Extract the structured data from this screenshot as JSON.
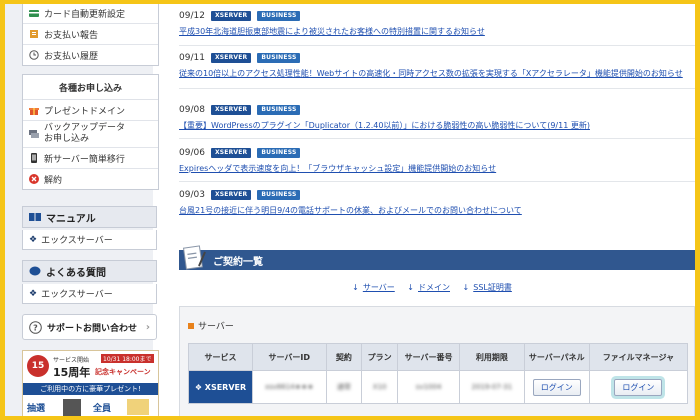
{
  "sidebar": {
    "top_items": [
      {
        "label": "カード自動更新設定",
        "icon": "card-icon"
      },
      {
        "label": "お支払い報告",
        "icon": "report-icon"
      },
      {
        "label": "お支払い履歴",
        "icon": "clock-icon"
      }
    ],
    "apply_category": "各種お申し込み",
    "apply_items": [
      {
        "label": "プレゼントドメイン",
        "icon": "gift-icon"
      },
      {
        "label": "バックアップデータ",
        "label2": "お申し込み",
        "icon": "backup-icon"
      },
      {
        "label": "新サーバー簡単移行",
        "icon": "phone-icon"
      },
      {
        "label": "解約",
        "icon": "cancel-icon"
      }
    ],
    "manual": {
      "title": "マニュアル",
      "sub": "エックスサーバー"
    },
    "faq": {
      "title": "よくある質問",
      "sub": "エックスサーバー"
    },
    "support": {
      "title": "サポートお問い合わせ"
    },
    "banner": {
      "num": "15",
      "text1": "サービス開始",
      "text2": "10/31 18:00まで",
      "text3": "15周年",
      "text4": "記念キャンペーン",
      "text5": "ご利用中の方に豪華プレゼント!",
      "text6": "抽選",
      "text7": "全員"
    }
  },
  "news": [
    {
      "date": "09/12",
      "badges": [
        "XSERVER",
        "BUSINESS"
      ],
      "title": "平成30年北海道胆振東部地震により被災されたお客様への特別措置に関するお知らせ"
    },
    {
      "date": "09/11",
      "badges": [
        "XSERVER",
        "BUSINESS"
      ],
      "title": "従来の10倍以上のアクセス処理性能！Webサイトの高速化・同時アクセス数の拡張を実現する「Xアクセラレータ」機能提供開始のお知らせ"
    },
    {
      "date": "09/08",
      "badges": [
        "XSERVER",
        "BUSINESS"
      ],
      "title": "【重要】WordPressのプラグイン「Duplicator（1.2.40以前）」における脆弱性の高い脆弱性について(9/11 更新)"
    },
    {
      "date": "09/06",
      "badges": [
        "XSERVER",
        "BUSINESS"
      ],
      "title": "Expiresヘッダで表示速度を向上！「ブラウザキャッシュ設定」機能提供開始のお知らせ"
    },
    {
      "date": "09/03",
      "badges": [
        "XSERVER",
        "BUSINESS"
      ],
      "title": "台風21号の接近に伴う明日9/4の電話サポートの休業、およびメールでのお問い合わせについて"
    }
  ],
  "contract": {
    "title": "ご契約一覧",
    "links": [
      "サーバー",
      "ドメイン",
      "SSL証明書"
    ]
  },
  "server": {
    "section_title": "サーバー",
    "headers": [
      "サービス",
      "サーバーID",
      "契約",
      "プラン",
      "サーバー番号",
      "利用期限",
      "サーバーパネル",
      "ファイルマネージャ"
    ],
    "row": {
      "service": "XSERVER",
      "server_id": "xsv8614★★★",
      "contract": "通常",
      "plan": "X10",
      "server_number": "sv1004",
      "expiry": "2019-07-31",
      "panel_button": "ログイン",
      "filemanager_button": "ログイン"
    }
  },
  "colors": {
    "frame_border": "#f5c518",
    "navy": "#30578f",
    "link": "#1f4fb0",
    "highlight": "#bfe4e8"
  }
}
